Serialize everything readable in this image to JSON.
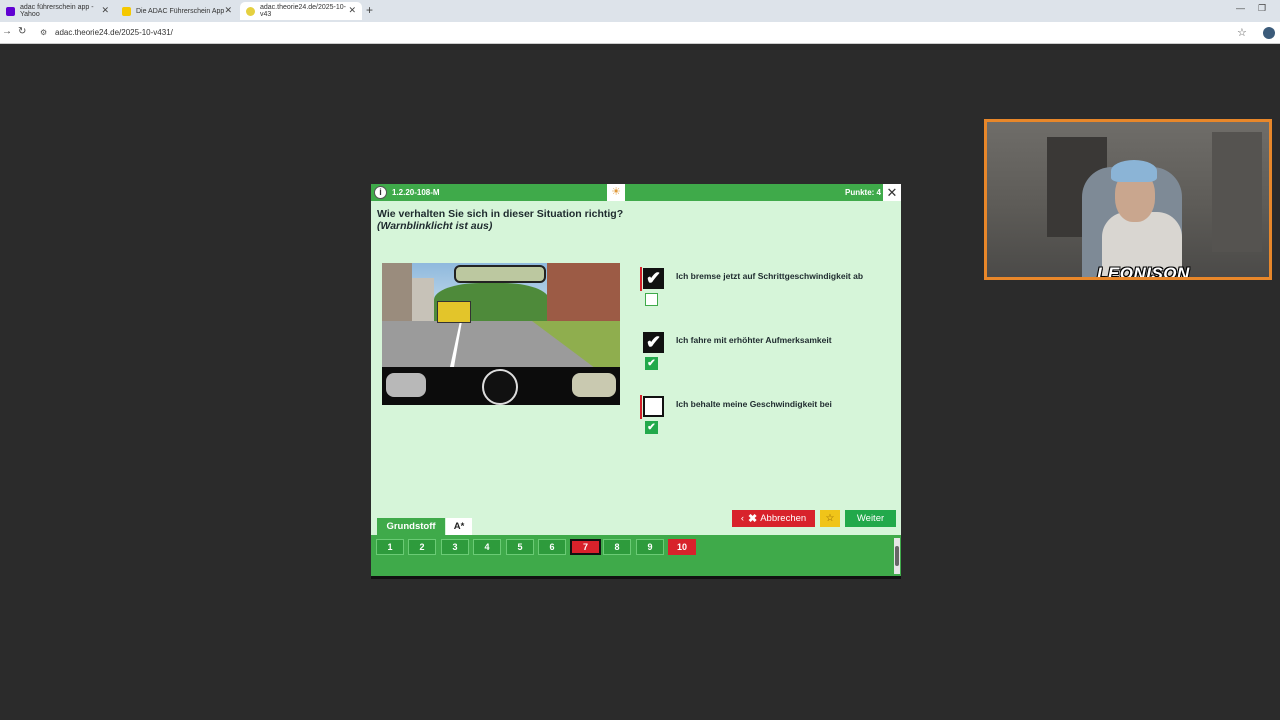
{
  "browser": {
    "tabs": [
      {
        "title": "adac führerschein app - Yahoo",
        "icon_color": "#6001d2"
      },
      {
        "title": "Die ADAC Führerschein App",
        "icon_color": "#f5c800"
      },
      {
        "title": "adac.theorie24.de/2025-10-v43",
        "icon_color": "#e5d040"
      }
    ],
    "url": "adac.theorie24.de/2025-10-v431/"
  },
  "webcam": {
    "logo": "LEONISON"
  },
  "quiz": {
    "question_id": "1.2.20-108-M",
    "points": "Punkte: 4",
    "question": "Wie verhalten Sie sich in dieser Situation richtig?",
    "note": "(Warnblinklicht ist aus)",
    "answers": [
      {
        "text": "Ich bremse jetzt auf Schrittgeschwindigkeit ab",
        "user_checked": true,
        "solution_checked": false,
        "marked_wrong": true
      },
      {
        "text": "Ich fahre mit erhöhter Aufmerksamkeit",
        "user_checked": true,
        "solution_checked": true,
        "marked_wrong": false
      },
      {
        "text": "Ich behalte meine Geschwindigkeit bei",
        "user_checked": false,
        "solution_checked": true,
        "marked_wrong": true
      }
    ],
    "buttons": {
      "cancel": "Abbrechen",
      "next": "Weiter"
    },
    "nav": {
      "section": "Grundstoff",
      "class": "A*",
      "questions": [
        {
          "label": "1",
          "state": "normal"
        },
        {
          "label": "2",
          "state": "normal"
        },
        {
          "label": "3",
          "state": "normal"
        },
        {
          "label": "4",
          "state": "normal"
        },
        {
          "label": "5",
          "state": "normal"
        },
        {
          "label": "6",
          "state": "normal"
        },
        {
          "label": "7",
          "state": "current"
        },
        {
          "label": "8",
          "state": "normal"
        },
        {
          "label": "9",
          "state": "normal"
        },
        {
          "label": "10",
          "state": "wrong"
        }
      ]
    }
  },
  "colors": {
    "accent_green": "#3faa4a",
    "error_red": "#d8222b",
    "panel_bg": "#d6f5d9"
  }
}
